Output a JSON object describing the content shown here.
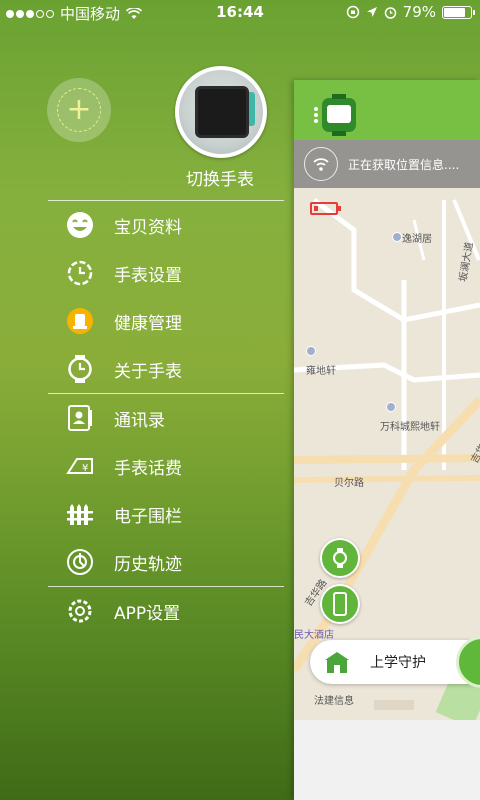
{
  "status_bar": {
    "carrier": "中国移动",
    "time": "16:44",
    "battery": "79%",
    "battery_level": 0.79
  },
  "profile": {
    "switch_label": "切换手表"
  },
  "menu": {
    "group1": [
      {
        "label": "宝贝资料",
        "icon": "smiley-face-icon"
      },
      {
        "label": "手表设置",
        "icon": "watch-gear-icon"
      },
      {
        "label": "健康管理",
        "icon": "health-badge-icon"
      },
      {
        "label": "关于手表",
        "icon": "watch-clock-icon"
      }
    ],
    "group2": [
      {
        "label": "通讯录",
        "icon": "contacts-icon"
      },
      {
        "label": "手表话费",
        "icon": "yuan-tag-icon"
      },
      {
        "label": "电子围栏",
        "icon": "fence-icon"
      },
      {
        "label": "历史轨迹",
        "icon": "history-track-icon"
      }
    ],
    "group3": [
      {
        "label": "APP设置",
        "icon": "gear-icon"
      }
    ]
  },
  "main": {
    "location_status": "正在获取位置信息....",
    "map_labels": [
      "逸湖居",
      "坂澜大道",
      "雍地轩",
      "万科城熙地轩",
      "吉华",
      "贝尔路",
      "吉华路",
      "民大酒店",
      "法建信息"
    ],
    "guard_label": "上学守护"
  },
  "colors": {
    "accent_green": "#77c043",
    "low_battery": "#e53b3b"
  }
}
